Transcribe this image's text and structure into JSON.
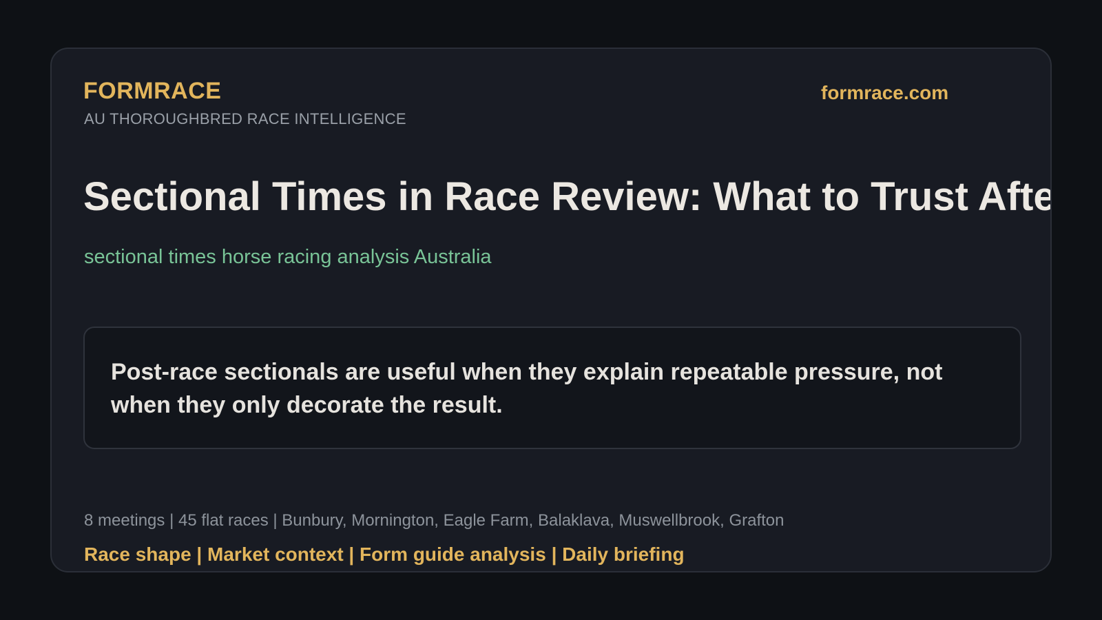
{
  "header": {
    "brand": "FORMRACE",
    "tagline": "AU THOROUGHBRED RACE INTELLIGENCE",
    "site": "formrace.com"
  },
  "article": {
    "headline": "Sectional Times in Race Review: What to Trust After the",
    "keyword": "sectional times horse racing analysis Australia",
    "quote": "Post-race sectionals are useful when they explain repeatable pressure, not when they only decorate the result."
  },
  "footer": {
    "meta": "8 meetings | 45 flat races | Bunbury, Mornington, Eagle Farm, Balaklava, Muswellbrook, Grafton",
    "nav": "Race shape | Market context | Form guide analysis | Daily briefing"
  },
  "colors": {
    "background": "#0e1115",
    "card": "#181b23",
    "accent": "#e2b55c",
    "keyword": "#79c497",
    "headline": "#ece8e2"
  }
}
